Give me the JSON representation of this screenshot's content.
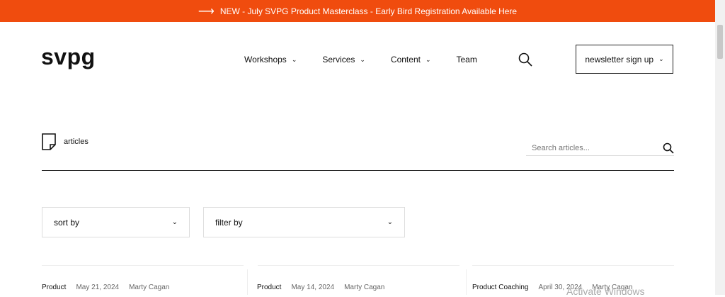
{
  "banner": {
    "text": "NEW - July SVPG Product Masterclass - Early Bird Registration Available Here"
  },
  "header": {
    "logo": "svpg",
    "nav": [
      "Workshops",
      "Services",
      "Content",
      "Team"
    ],
    "newsletter": "newsletter sign up"
  },
  "page": {
    "section_label": "articles",
    "search_placeholder": "Search articles..."
  },
  "filters": {
    "sort": "sort by",
    "filter": "filter by"
  },
  "cards": [
    {
      "category": "Product",
      "date": "May 21, 2024",
      "author": "Marty Cagan"
    },
    {
      "category": "Product",
      "date": "May 14, 2024",
      "author": "Marty Cagan"
    },
    {
      "category": "Product Coaching",
      "date": "April 30, 2024",
      "author": "Marty Cagan"
    }
  ],
  "watermark": "Activate Windows"
}
